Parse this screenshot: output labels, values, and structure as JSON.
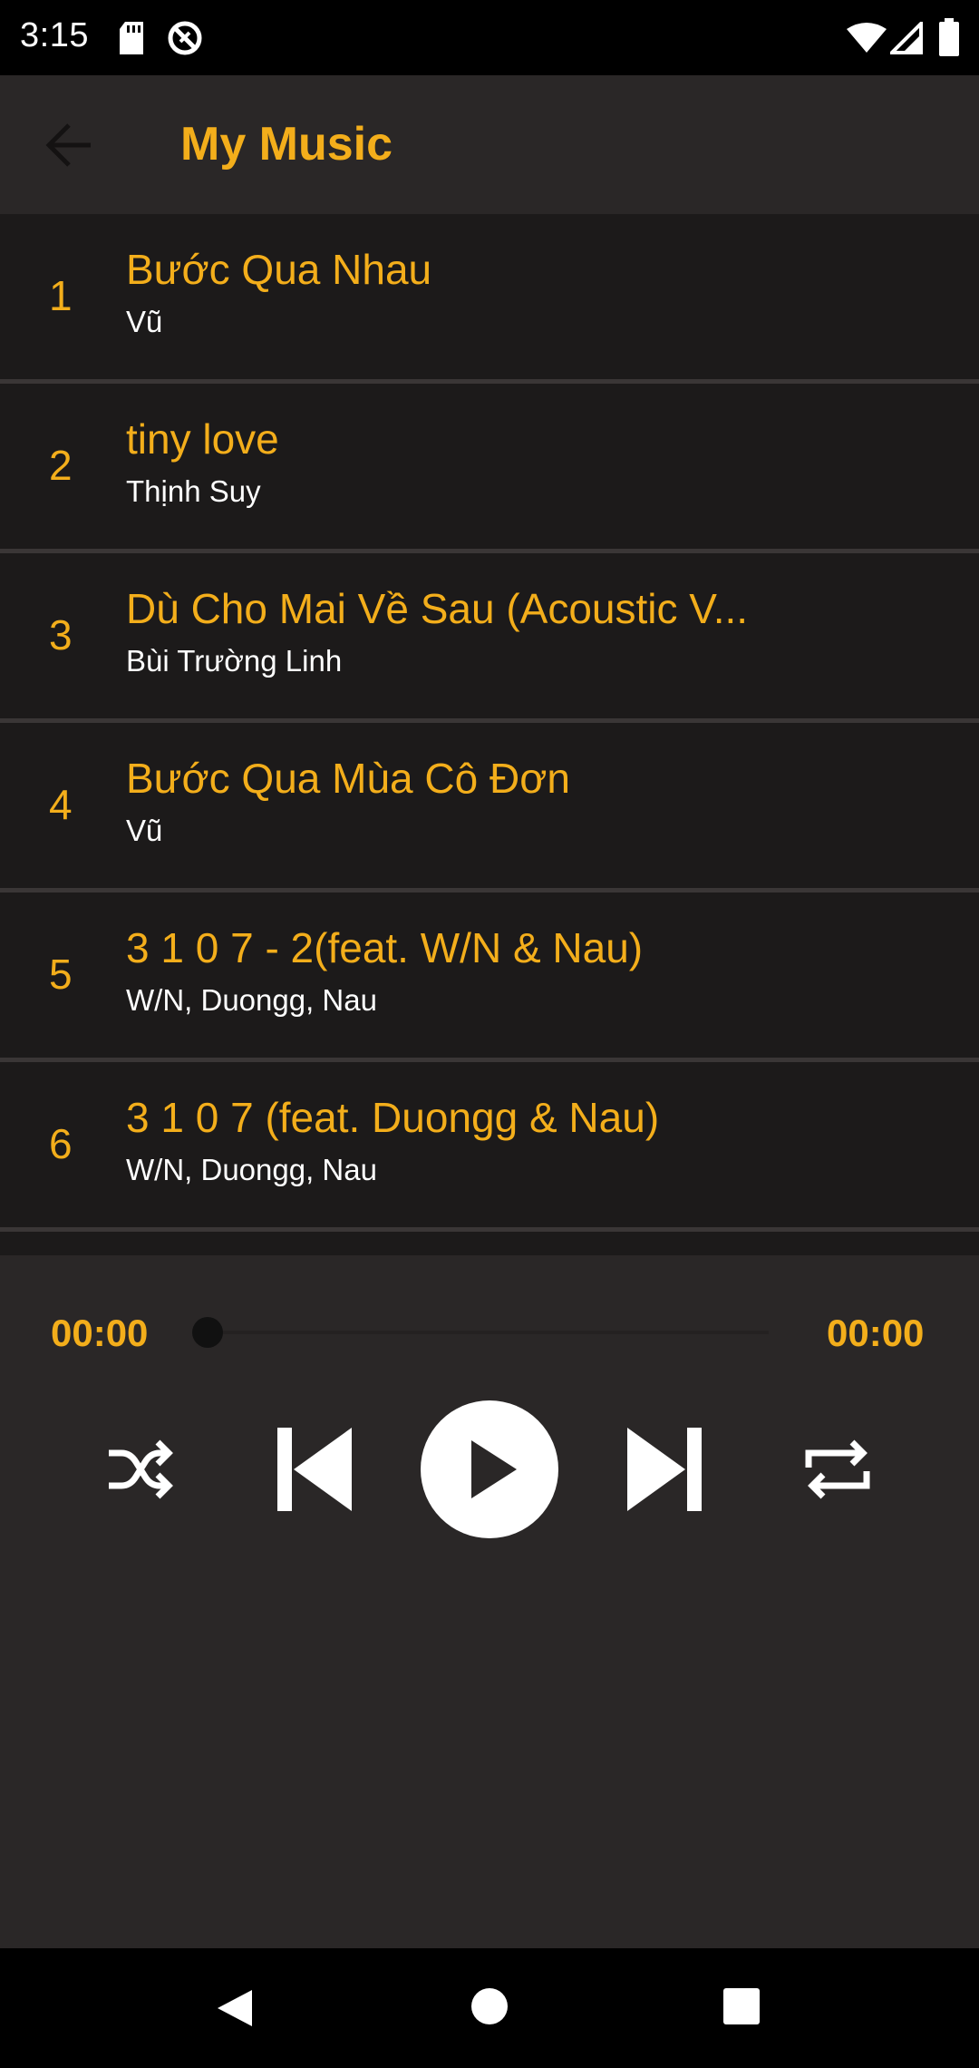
{
  "status_bar": {
    "time": "3:15",
    "icons": [
      "sd-card-icon",
      "no-disturb-icon",
      "wifi-icon",
      "signal-icon",
      "battery-icon"
    ]
  },
  "app_bar": {
    "back_icon": "arrow-back-icon",
    "title": "My Music"
  },
  "songs": [
    {
      "number": "1",
      "title": "Bước Qua Nhau",
      "artist": "Vũ"
    },
    {
      "number": "2",
      "title": "tiny love",
      "artist": "Thịnh Suy"
    },
    {
      "number": "3",
      "title": "Dù Cho Mai Về Sau (Acoustic V...",
      "artist": "Bùi Trường Linh"
    },
    {
      "number": "4",
      "title": "Bước Qua Mùa Cô Đơn",
      "artist": "Vũ"
    },
    {
      "number": "5",
      "title": "3 1 0 7 - 2(feat. W/N & Nau)",
      "artist": "W/N, Duongg, Nau"
    },
    {
      "number": "6",
      "title": "3 1 0 7 (feat. Duongg & Nau)",
      "artist": "W/N, Duongg, Nau"
    }
  ],
  "player": {
    "elapsed": "00:00",
    "total": "00:00",
    "progress": 0,
    "controls": [
      "shuffle-icon",
      "skip-previous-icon",
      "play-icon",
      "skip-next-icon",
      "repeat-icon"
    ]
  },
  "nav_bar": {
    "icons": [
      "nav-back-icon",
      "nav-home-icon",
      "nav-recents-icon"
    ]
  },
  "colors": {
    "accent": "#f3ae1b",
    "app_bar_bg": "#2a2727",
    "row_bg": "#1c1a1a",
    "divider": "#3a3636"
  }
}
